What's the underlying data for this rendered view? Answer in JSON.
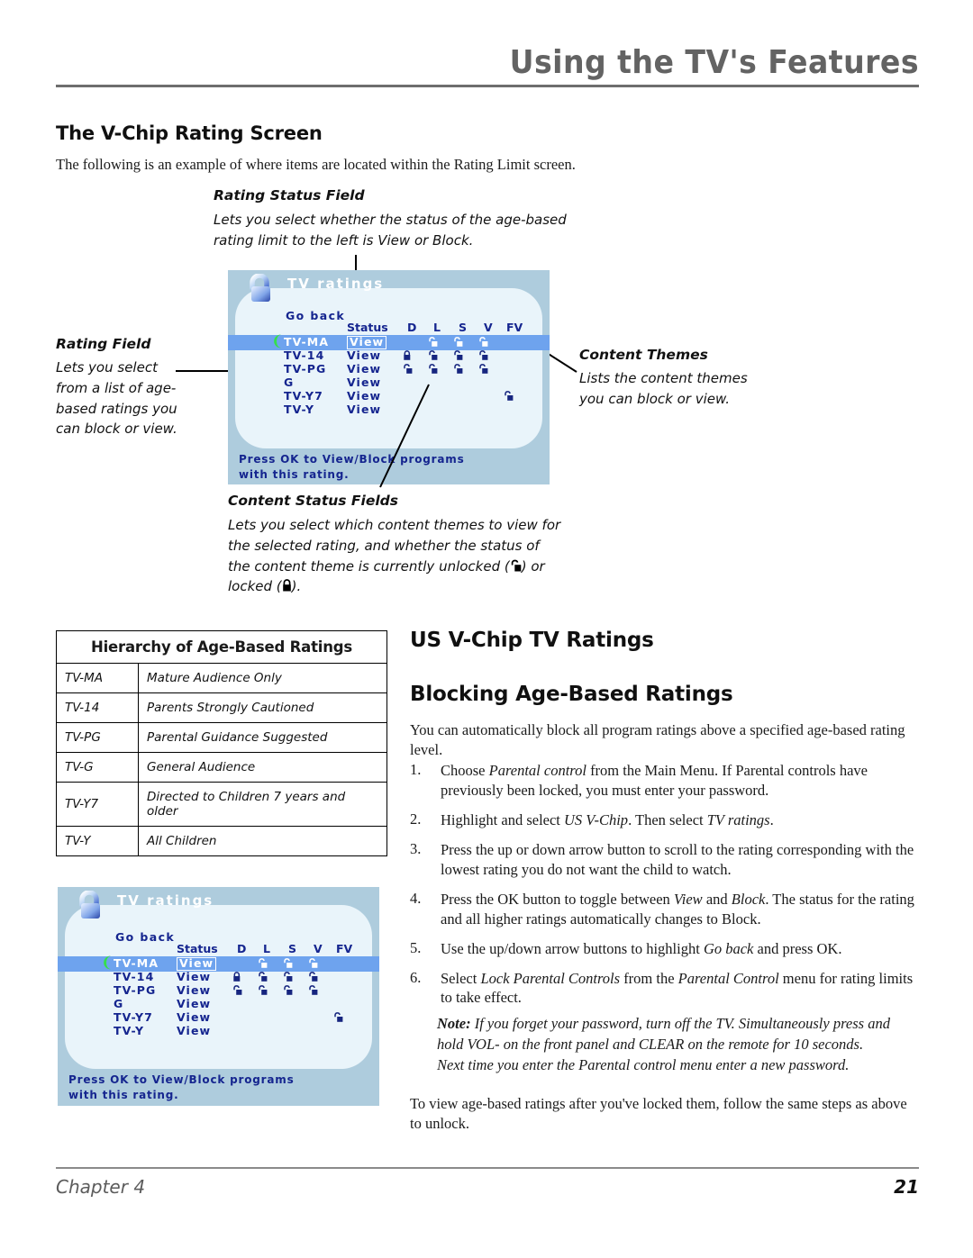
{
  "header": {
    "title": "Using the TV's Features"
  },
  "sections": {
    "vchip_screen_heading": "The V-Chip Rating Screen",
    "vchip_screen_intro": "The following is an example of where items are located within the Rating Limit screen.",
    "us_vchip_heading": "US V-Chip TV Ratings",
    "blocking_heading": "Blocking Age-Based Ratings",
    "blocking_intro": "You can automatically block all program ratings above a specified age-based rating level."
  },
  "callouts": {
    "rating_status": {
      "title": "Rating Status Field",
      "lines": [
        "Lets you select whether the status of the age-based",
        "rating limit to the left is View or Block."
      ]
    },
    "rating_field": {
      "title": "Rating Field",
      "lines": [
        "Lets you select",
        "from a list of age-",
        "based ratings you",
        "can block or view."
      ]
    },
    "content_themes": {
      "title": "Content Themes",
      "lines": [
        "Lists the content themes",
        "you can block or view."
      ]
    },
    "content_status": {
      "title": "Content Status Fields",
      "line1": "Lets you select which content themes to view for",
      "line2": "the selected rating, and whether the status of",
      "line3_a": "the content theme is currently unlocked (",
      "line3_b": ") or",
      "line4_a": "locked (",
      "line4_b": ")."
    }
  },
  "osd": {
    "title": "TV ratings",
    "go_back": "Go back",
    "columns": [
      "Status",
      "D",
      "L",
      "S",
      "V",
      "FV"
    ],
    "rows": [
      {
        "name": "TV-MA",
        "status": "View",
        "selected": true,
        "locks": {
          "D": "",
          "L": "unlocked",
          "S": "unlocked",
          "V": "unlocked",
          "FV": ""
        }
      },
      {
        "name": "TV-14",
        "status": "View",
        "selected": false,
        "locks": {
          "D": "locked",
          "L": "unlocked",
          "S": "unlocked",
          "V": "unlocked",
          "FV": ""
        }
      },
      {
        "name": "TV-PG",
        "status": "View",
        "selected": false,
        "locks": {
          "D": "unlocked",
          "L": "unlocked",
          "S": "unlocked",
          "V": "unlocked",
          "FV": ""
        }
      },
      {
        "name": "G",
        "status": "View",
        "selected": false,
        "locks": {
          "D": "",
          "L": "",
          "S": "",
          "V": "",
          "FV": ""
        }
      },
      {
        "name": "TV-Y7",
        "status": "View",
        "selected": false,
        "locks": {
          "D": "",
          "L": "",
          "S": "",
          "V": "",
          "FV": "unlocked"
        }
      },
      {
        "name": "TV-Y",
        "status": "View",
        "selected": false,
        "locks": {
          "D": "",
          "L": "",
          "S": "",
          "V": "",
          "FV": ""
        }
      }
    ],
    "footer_line1": "Press OK to View/Block programs",
    "footer_line2": "with this rating.",
    "colors": {
      "panel_bg": "#aeccdd",
      "inner_bg": "#e9f4fa",
      "text_blue": "#15258f",
      "highlight": "#6ea3ee",
      "cursor_green": "#35e04a"
    }
  },
  "hierarchy_table": {
    "title": "Hierarchy of Age-Based Ratings",
    "rows": [
      {
        "code": "TV-MA",
        "desc": "Mature Audience Only"
      },
      {
        "code": "TV-14",
        "desc": "Parents Strongly Cautioned"
      },
      {
        "code": "TV-PG",
        "desc": "Parental Guidance Suggested"
      },
      {
        "code": "TV-G",
        "desc": "General Audience"
      },
      {
        "code": "TV-Y7",
        "desc": "Directed to Children 7 years and older"
      },
      {
        "code": "TV-Y",
        "desc": "All Children"
      }
    ]
  },
  "steps": [
    {
      "num": "1.",
      "parts": [
        {
          "t": "Choose ",
          "i": false
        },
        {
          "t": "Parental control",
          "i": true
        },
        {
          "t": " from the Main Menu. If Parental controls have previously been locked, you must enter your password.",
          "i": false
        }
      ]
    },
    {
      "num": "2.",
      "parts": [
        {
          "t": "Highlight and select ",
          "i": false
        },
        {
          "t": "US V-Chip",
          "i": true
        },
        {
          "t": ". Then select ",
          "i": false
        },
        {
          "t": "TV ratings",
          "i": true
        },
        {
          "t": ".",
          "i": false
        }
      ]
    },
    {
      "num": "3.",
      "parts": [
        {
          "t": "Press the up or down arrow button to scroll to the rating corresponding with the lowest rating you do not want the child to watch.",
          "i": false
        }
      ]
    },
    {
      "num": "4.",
      "parts": [
        {
          "t": "Press the OK button to toggle between ",
          "i": false
        },
        {
          "t": "View",
          "i": true
        },
        {
          "t": " and ",
          "i": false
        },
        {
          "t": "Block",
          "i": true
        },
        {
          "t": ". The status for the rating and all higher ratings automatically changes to Block.",
          "i": false
        }
      ]
    },
    {
      "num": "5.",
      "parts": [
        {
          "t": "Use the up/down arrow buttons to highlight ",
          "i": false
        },
        {
          "t": "Go back",
          "i": true
        },
        {
          "t": " and press OK.",
          "i": false
        }
      ]
    },
    {
      "num": "6.",
      "parts": [
        {
          "t": "Select ",
          "i": false
        },
        {
          "t": "Lock Parental Controls",
          "i": true
        },
        {
          "t": " from the ",
          "i": false
        },
        {
          "t": "Parental Control",
          "i": true
        },
        {
          "t": " menu for rating limits to take effect.",
          "i": false
        }
      ]
    }
  ],
  "note": {
    "label": "Note:",
    "text": " If you forget your password, turn off the TV. Simultaneously press and hold VOL- on the front panel and CLEAR on the remote for 10 seconds. Next time you enter the Parental control menu enter a new password."
  },
  "closing_paragraph": "To view age-based ratings after you've locked them, follow the same steps as above to unlock.",
  "footer": {
    "chapter": "Chapter 4",
    "page": "21"
  }
}
